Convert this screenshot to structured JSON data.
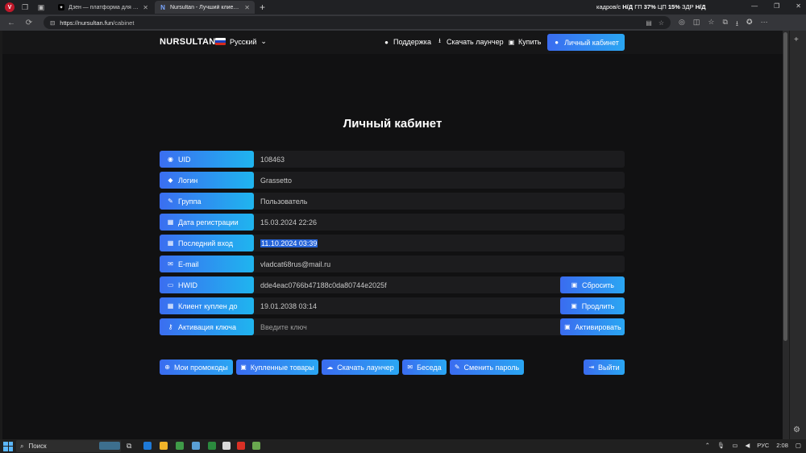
{
  "browser": {
    "tabs": [
      {
        "label": "Дзен — платформа для просмот",
        "active": false
      },
      {
        "label": "Nursultan - Лучший клиент с мо",
        "active": true
      }
    ],
    "url_host": "https://nursultan.fun",
    "url_path": "/cabinet",
    "overlay_prefix": "кадров/с",
    "overlay_fps": "Н/Д",
    "overlay_gpu_label": "ГП",
    "overlay_gpu": "37%",
    "overlay_cpu_label": "ЦП",
    "overlay_cpu_value": "15%",
    "overlay_ram_label": "ЗДР",
    "overlay_ram": "Н/Д"
  },
  "header": {
    "brand": "NURSULTAN",
    "language": "Русский",
    "nav": {
      "support": "Поддержка",
      "download": "Скачать лаунчер",
      "buy": "Купить",
      "cabinet": "Личный кабинет"
    }
  },
  "page_title": "Личный кабинет",
  "profile": {
    "uid": {
      "label": "UID",
      "value": "108463"
    },
    "login": {
      "label": "Логин",
      "value": "Grassetto"
    },
    "group": {
      "label": "Группа",
      "value": "Пользователь"
    },
    "registered": {
      "label": "Дата регистрации",
      "value": "15.03.2024 22:26"
    },
    "last_login": {
      "label": "Последний вход",
      "value": "11.10.2024 03:39"
    },
    "email": {
      "label": "E-mail",
      "value": "vladcat68rus@mail.ru"
    },
    "hwid": {
      "label": "HWID",
      "value": "dde4eac0766b47188c0da80744e2025f",
      "button": "Сбросить"
    },
    "client_until": {
      "label": "Клиент куплен до",
      "value": "19.01.2038 03:14",
      "button": "Продлить"
    },
    "key": {
      "label": "Активация ключа",
      "placeholder": "Введите ключ",
      "button": "Активировать"
    }
  },
  "actions": {
    "promocodes": "Мои промокоды",
    "purchased": "Купленные товары",
    "download": "Скачать лаунчер",
    "chat": "Беседа",
    "change_password": "Сменить пароль",
    "logout": "Выйти"
  },
  "taskbar": {
    "search": "Поиск",
    "lang": "РУС",
    "time": "2:08"
  },
  "colors": {
    "accent_start": "#3a6cf0",
    "accent_end": "#2aa6f2",
    "background": "#111112",
    "row_bg": "#1c1c1e",
    "selection": "#2563d8"
  }
}
